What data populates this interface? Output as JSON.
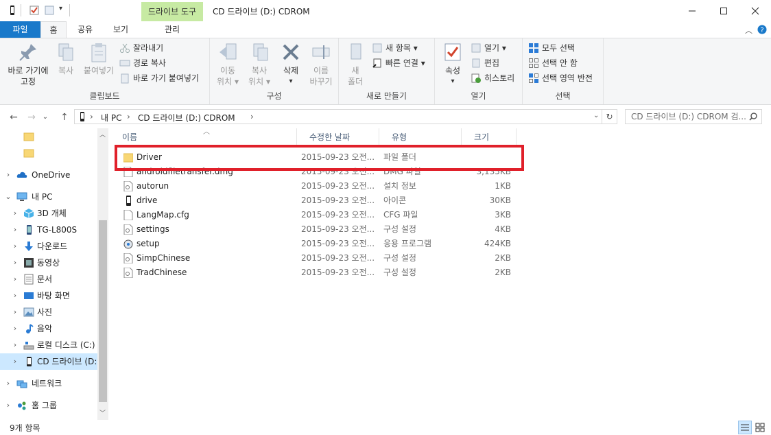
{
  "window": {
    "title": "CD 드라이브 (D:) CDROM",
    "tool_tab_header": "드라이브 도구",
    "minimize_icon": "minimize-icon",
    "maximize_icon": "maximize-icon",
    "close_icon": "close-icon"
  },
  "ribbon_tabs": {
    "file": "파일",
    "home": "홈",
    "share": "공유",
    "view": "보기",
    "manage": "관리"
  },
  "ribbon": {
    "clipboard": {
      "label": "클립보드",
      "pin": "바로 가기에",
      "pin2": "고정",
      "copy": "복사",
      "paste": "붙여넣기",
      "cut": "잘라내기",
      "copy_path": "경로 복사",
      "paste_shortcut": "바로 가기 붙여넣기"
    },
    "organize": {
      "label": "구성",
      "move_to": "이동",
      "move_to2": "위치",
      "copy_to": "복사",
      "copy_to2": "위치",
      "delete": "삭제",
      "rename": "이름",
      "rename2": "바꾸기"
    },
    "new": {
      "label": "새로 만들기",
      "new_folder": "새",
      "new_folder2": "폴더",
      "new_item": "새 항목",
      "easy_access": "빠른 연결"
    },
    "open": {
      "label": "열기",
      "properties": "속성",
      "open": "열기",
      "edit": "편집",
      "history": "히스토리"
    },
    "select": {
      "label": "선택",
      "select_all": "모두 선택",
      "select_none": "선택 안 함",
      "invert": "선택 영역 반전"
    }
  },
  "address": {
    "crumbs": [
      "내 PC",
      "CD 드라이브 (D:) CDROM"
    ],
    "search_placeholder": "CD 드라이브 (D:) CDROM 검..."
  },
  "nav": {
    "items": [
      {
        "label": "",
        "icon": "folder-icon"
      },
      {
        "label": "",
        "icon": "folder-icon"
      },
      {
        "label": "OneDrive",
        "icon": "cloud-icon"
      },
      {
        "label": "내 PC",
        "icon": "computer-icon"
      },
      {
        "label": "3D 개체",
        "icon": "cube-icon"
      },
      {
        "label": "TG-L800S",
        "icon": "phone-icon"
      },
      {
        "label": "다운로드",
        "icon": "download-icon"
      },
      {
        "label": "동영상",
        "icon": "video-icon"
      },
      {
        "label": "문서",
        "icon": "document-icon"
      },
      {
        "label": "바탕 화면",
        "icon": "desktop-icon"
      },
      {
        "label": "사진",
        "icon": "picture-icon"
      },
      {
        "label": "음악",
        "icon": "music-icon"
      },
      {
        "label": "로컬 디스크 (C:)",
        "icon": "disk-icon"
      },
      {
        "label": "CD 드라이브 (D:) CDROM",
        "icon": "cd-drive-icon"
      },
      {
        "label": "네트워크",
        "icon": "network-icon"
      },
      {
        "label": "홈 그룹",
        "icon": "homegroup-icon"
      }
    ]
  },
  "columns": {
    "name": "이름",
    "date": "수정한 날짜",
    "type": "유형",
    "size": "크기"
  },
  "files": [
    {
      "name": "Driver",
      "date": "2015-09-23 오전...",
      "type": "파일 폴더",
      "size": "",
      "icon": "folder-icon"
    },
    {
      "name": "androidfiletransfer.dmg",
      "date": "2015-09-23 오전...",
      "type": "DMG 파일",
      "size": "3,135KB",
      "icon": "file-icon"
    },
    {
      "name": "autorun",
      "date": "2015-09-23 오전...",
      "type": "설치 정보",
      "size": "1KB",
      "icon": "settings-file-icon"
    },
    {
      "name": "drive",
      "date": "2015-09-23 오전...",
      "type": "아이콘",
      "size": "30KB",
      "icon": "phone-icon"
    },
    {
      "name": "LangMap.cfg",
      "date": "2015-09-23 오전...",
      "type": "CFG 파일",
      "size": "3KB",
      "icon": "file-icon"
    },
    {
      "name": "settings",
      "date": "2015-09-23 오전...",
      "type": "구성 설정",
      "size": "4KB",
      "icon": "settings-file-icon"
    },
    {
      "name": "setup",
      "date": "2015-09-23 오전...",
      "type": "응용 프로그램",
      "size": "424KB",
      "icon": "setup-icon"
    },
    {
      "name": "SimpChinese",
      "date": "2015-09-23 오전...",
      "type": "구성 설정",
      "size": "2KB",
      "icon": "settings-file-icon"
    },
    {
      "name": "TradChinese",
      "date": "2015-09-23 오전...",
      "type": "구성 설정",
      "size": "2KB",
      "icon": "settings-file-icon"
    }
  ],
  "status": {
    "item_count": "9개 항목"
  },
  "colors": {
    "file_tab": "#1979ca",
    "tool_tab": "#c7eaa3",
    "highlight": "#e0202a",
    "selected_nav": "#cce8ff"
  }
}
